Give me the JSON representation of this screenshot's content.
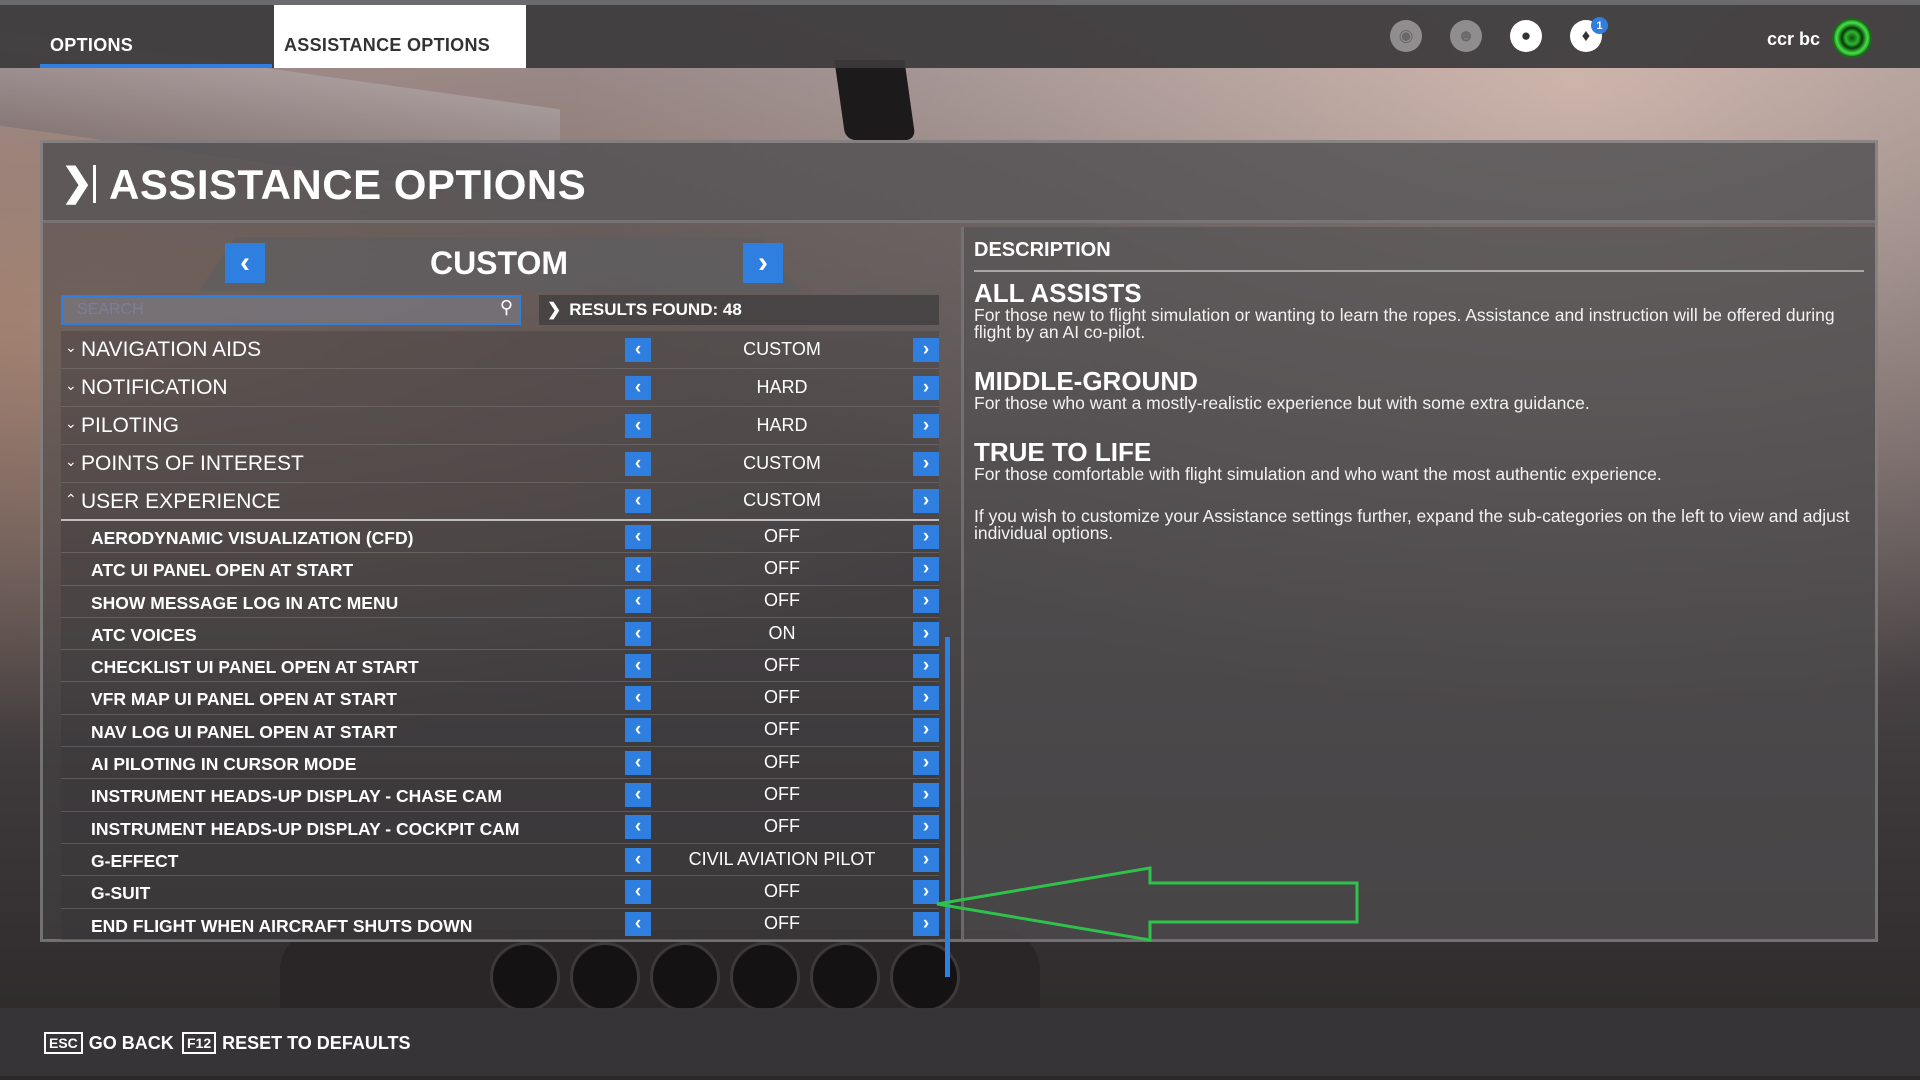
{
  "tabs": [
    {
      "label": "OPTIONS"
    },
    {
      "label": "ASSISTANCE OPTIONS"
    }
  ],
  "header": {
    "notification_count": "1",
    "user_name": "ccr bc",
    "icons": [
      "activity-icon",
      "friends-icon",
      "profile-icon",
      "notifications-icon"
    ]
  },
  "page": {
    "title": "ASSISTANCE OPTIONS"
  },
  "preset": {
    "label": "CUSTOM"
  },
  "search": {
    "placeholder": "SEARCH",
    "value": ""
  },
  "results": {
    "label": "RESULTS FOUND: 48"
  },
  "categories": [
    {
      "label": "NAVIGATION AIDS",
      "value": "CUSTOM",
      "expanded": false
    },
    {
      "label": "NOTIFICATION",
      "value": "HARD",
      "expanded": false
    },
    {
      "label": "PILOTING",
      "value": "HARD",
      "expanded": false
    },
    {
      "label": "POINTS OF INTEREST",
      "value": "CUSTOM",
      "expanded": false
    },
    {
      "label": "USER EXPERIENCE",
      "value": "CUSTOM",
      "expanded": true
    }
  ],
  "user_experience_items": [
    {
      "label": "AERODYNAMIC VISUALIZATION (CFD)",
      "value": "OFF"
    },
    {
      "label": "ATC UI PANEL OPEN AT START",
      "value": "OFF"
    },
    {
      "label": "SHOW MESSAGE LOG IN ATC MENU",
      "value": "OFF"
    },
    {
      "label": "ATC VOICES",
      "value": "ON"
    },
    {
      "label": "CHECKLIST UI PANEL OPEN AT START",
      "value": "OFF"
    },
    {
      "label": "VFR MAP UI PANEL OPEN AT START",
      "value": "OFF"
    },
    {
      "label": "NAV LOG UI PANEL OPEN AT START",
      "value": "OFF"
    },
    {
      "label": "AI PILOTING IN CURSOR MODE",
      "value": "OFF"
    },
    {
      "label": "INSTRUMENT HEADS-UP DISPLAY - CHASE CAM",
      "value": "OFF"
    },
    {
      "label": "INSTRUMENT HEADS-UP DISPLAY - COCKPIT CAM",
      "value": "OFF"
    },
    {
      "label": "G-EFFECT",
      "value": "CIVIL AVIATION PILOT"
    },
    {
      "label": "G-SUIT",
      "value": "OFF"
    },
    {
      "label": "END FLIGHT WHEN AIRCRAFT SHUTS DOWN",
      "value": "OFF"
    }
  ],
  "description": {
    "heading": "DESCRIPTION",
    "all_assists_title": "ALL ASSISTS",
    "all_assists_text": "For those new to flight simulation or wanting to learn the ropes. Assistance and instruction will be offered during flight by an AI co-pilot.",
    "middle_title": "MIDDLE-GROUND",
    "middle_text": "For those who want a mostly-realistic experience but with some extra guidance.",
    "true_title": "TRUE TO LIFE",
    "true_text": "For those comfortable with flight simulation and who want the most authentic experience.",
    "customize_text": "If you wish to customize your Assistance settings further, expand the sub-categories on the left to view and adjust individual options."
  },
  "footer": {
    "back_key": "ESC",
    "back_label": "GO BACK",
    "reset_key": "F12",
    "reset_label": "RESET TO DEFAULTS"
  },
  "colors": {
    "accent": "#2e7fe0",
    "annotation_arrow": "#2fc24a"
  }
}
